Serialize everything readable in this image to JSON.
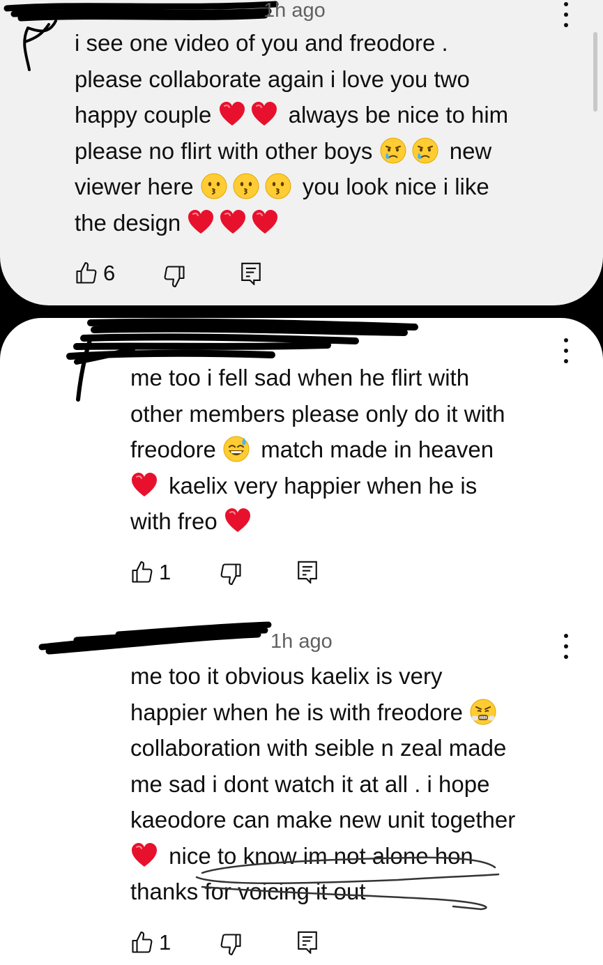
{
  "comments": [
    {
      "timestamp": "1h ago",
      "lines": [
        [
          {
            "t": "text",
            "v": "i see one video of you and freodore ."
          }
        ],
        [
          {
            "t": "text",
            "v": "please collaborate again i love you two"
          }
        ],
        [
          {
            "t": "text",
            "v": "happy couple "
          },
          {
            "t": "emoji",
            "v": "red-heart"
          },
          {
            "t": "emoji",
            "v": "red-heart"
          },
          {
            "t": "text",
            "v": " always be nice to him"
          }
        ],
        [
          {
            "t": "text",
            "v": "please no flirt with other boys "
          },
          {
            "t": "emoji",
            "v": "crying-face"
          },
          {
            "t": "emoji",
            "v": "crying-face"
          },
          {
            "t": "text",
            "v": " new"
          }
        ],
        [
          {
            "t": "text",
            "v": "viewer here "
          },
          {
            "t": "emoji",
            "v": "kissing-face"
          },
          {
            "t": "emoji",
            "v": "kissing-face"
          },
          {
            "t": "emoji",
            "v": "kissing-face"
          },
          {
            "t": "text",
            "v": " you look nice i like"
          }
        ],
        [
          {
            "t": "text",
            "v": "the design "
          },
          {
            "t": "emoji",
            "v": "red-heart"
          },
          {
            "t": "emoji",
            "v": "red-heart"
          },
          {
            "t": "emoji",
            "v": "red-heart"
          }
        ]
      ],
      "likes": "6"
    },
    {
      "timestamp": "",
      "lines": [
        [
          {
            "t": "text",
            "v": "me too i fell sad when he flirt with"
          }
        ],
        [
          {
            "t": "text",
            "v": "other members please only do it with"
          }
        ],
        [
          {
            "t": "text",
            "v": "freodore "
          },
          {
            "t": "emoji",
            "v": "sweat-smile-face"
          },
          {
            "t": "text",
            "v": " match made in heaven"
          }
        ],
        [
          {
            "t": "emoji",
            "v": "red-heart"
          },
          {
            "t": "text",
            "v": " kaelix very happier when he is"
          }
        ],
        [
          {
            "t": "text",
            "v": "with freo "
          },
          {
            "t": "emoji",
            "v": "red-heart"
          }
        ]
      ],
      "likes": "1"
    },
    {
      "timestamp": "1h ago",
      "lines": [
        [
          {
            "t": "text",
            "v": "me too it obvious kaelix is very"
          }
        ],
        [
          {
            "t": "text",
            "v": "happier when he is with freodore "
          },
          {
            "t": "emoji",
            "v": "steam-nose-face"
          }
        ],
        [
          {
            "t": "text",
            "v": "collaboration with seible n zeal made"
          }
        ],
        [
          {
            "t": "text",
            "v": "me sad i dont watch it at all . i hope"
          }
        ],
        [
          {
            "t": "text",
            "v": "kaeodore can make new unit together"
          }
        ],
        [
          {
            "t": "emoji",
            "v": "red-heart"
          },
          {
            "t": "text",
            "v": " nice to know im not alone hon"
          }
        ],
        [
          {
            "t": "text",
            "v": "thanks for voicing it out"
          }
        ]
      ],
      "likes": "1"
    }
  ],
  "icons": {
    "like": "thumbs-up-icon",
    "dislike": "thumbs-down-icon",
    "reply": "reply-comment-icon",
    "menu": "more-vertical-icon"
  },
  "colors": {
    "top_card": "#f1f1f1",
    "bottom_card": "#ffffff",
    "meta_text": "#606060",
    "heart": "#e8112d",
    "emoji_face": "#ffcc33"
  }
}
